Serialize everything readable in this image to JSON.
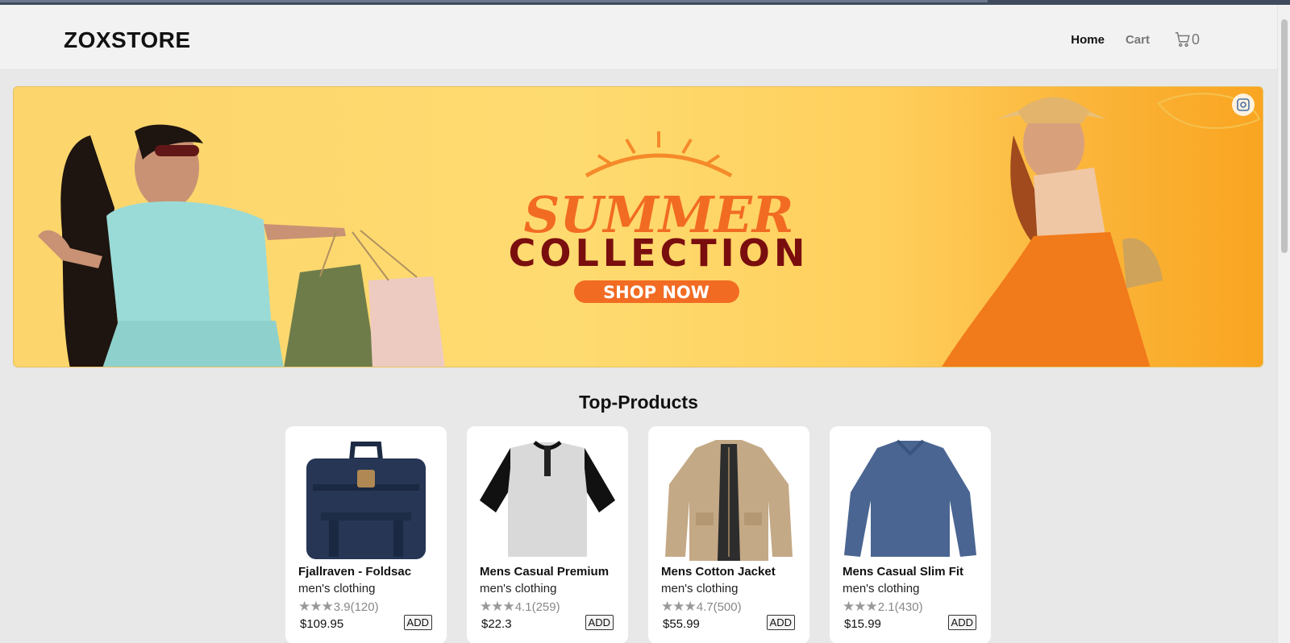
{
  "header": {
    "brand": "ZOXSTORE",
    "nav": {
      "home": "Home",
      "cart": "Cart",
      "cart_count": "0"
    }
  },
  "banner": {
    "alt": "SUMMER COLLECTION SHOP NOW"
  },
  "section": {
    "title": "Top-Products"
  },
  "products": [
    {
      "title": "Fjallraven - Foldsac",
      "category": "men's clothing",
      "rating": "3.9",
      "count": "(120)",
      "price": "$109.95",
      "add": "ADD",
      "stars": "★★★"
    },
    {
      "title": "Mens Casual Premium",
      "category": "men's clothing",
      "rating": "4.1",
      "count": "(259)",
      "price": "$22.3",
      "add": "ADD",
      "stars": "★★★"
    },
    {
      "title": "Mens Cotton Jacket",
      "category": "men's clothing",
      "rating": "4.7",
      "count": "(500)",
      "price": "$55.99",
      "add": "ADD",
      "stars": "★★★"
    },
    {
      "title": "Mens Casual Slim Fit",
      "category": "men's clothing",
      "rating": "2.1",
      "count": "(430)",
      "price": "$15.99",
      "add": "ADD",
      "stars": "★★★"
    }
  ],
  "colors": {
    "accent_banner": "#fdd66e",
    "brand_text": "#111111",
    "card_bg": "#ffffff"
  }
}
